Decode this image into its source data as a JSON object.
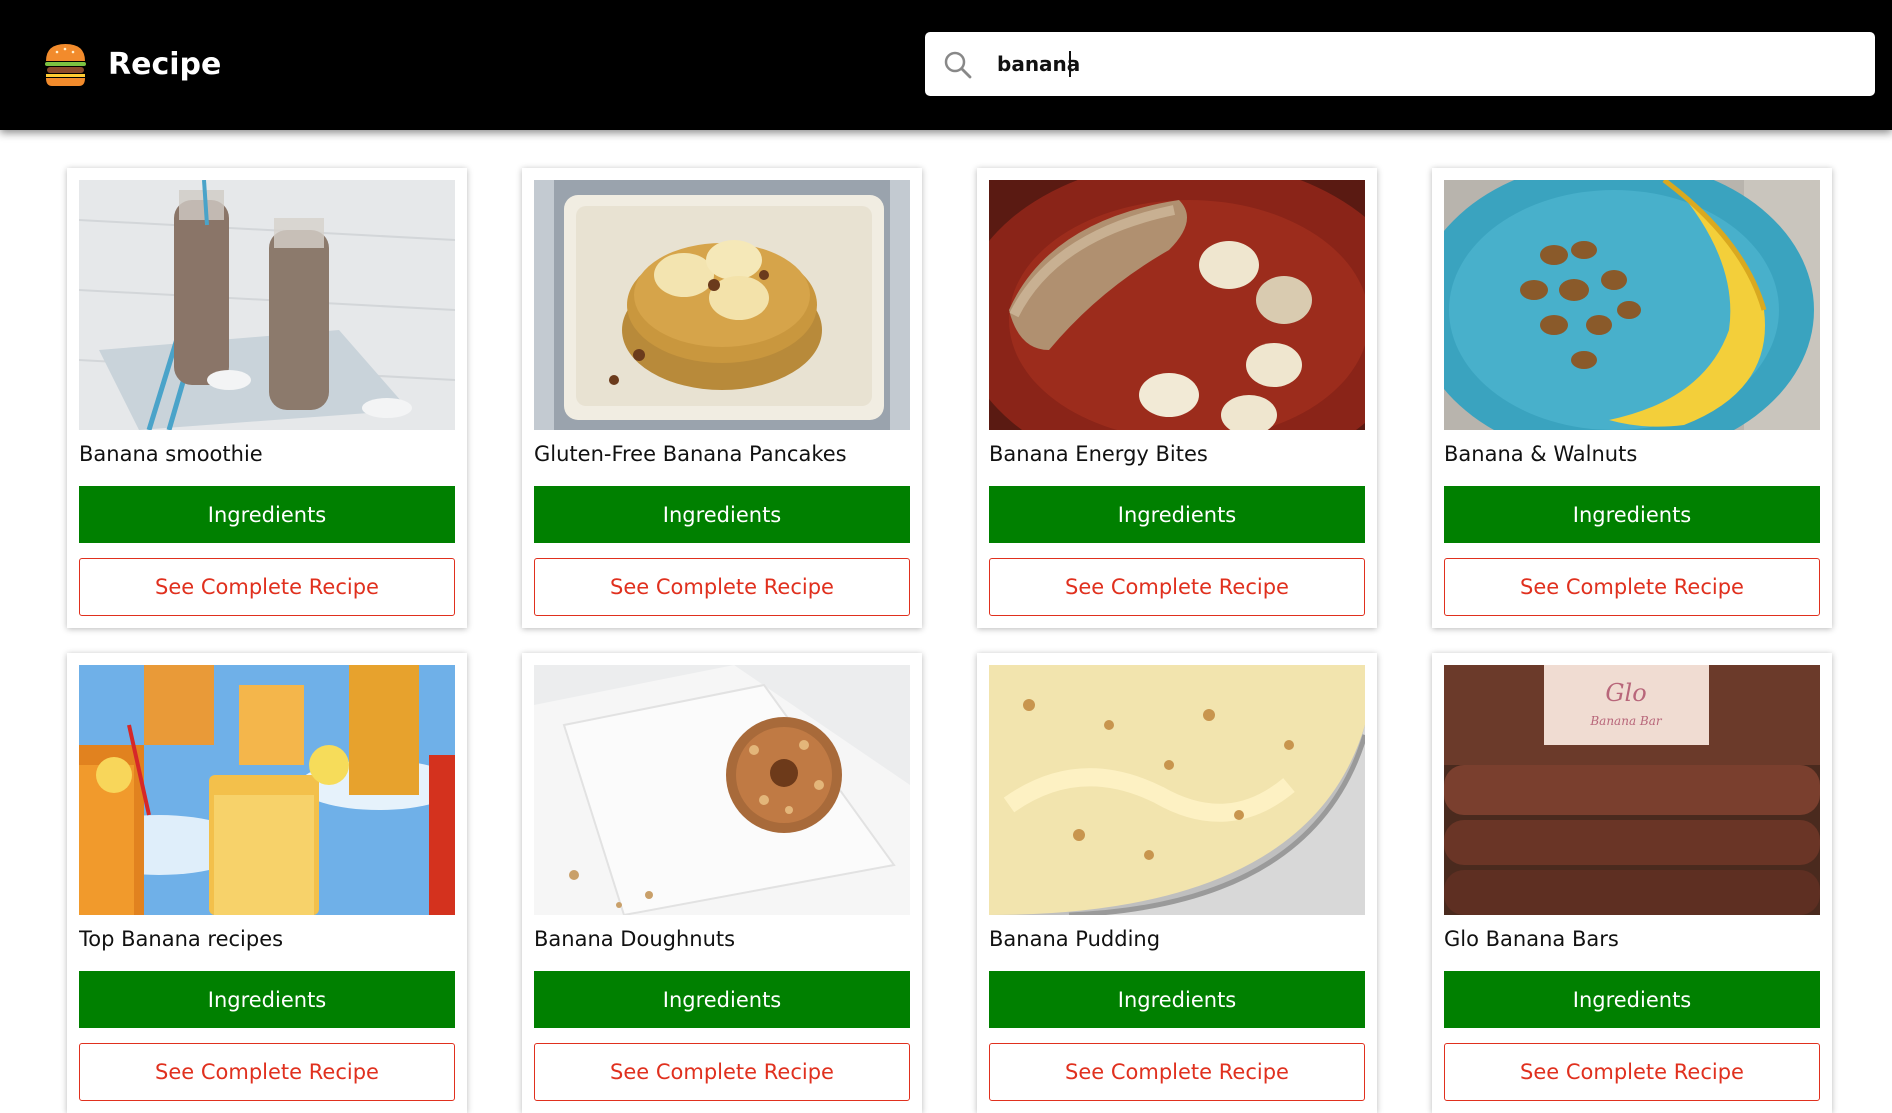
{
  "header": {
    "app_title": "Recipe",
    "logo_icon": "burger-icon",
    "search": {
      "icon": "search-icon",
      "value": "banana",
      "placeholder": ""
    }
  },
  "recipes": [
    {
      "title": "Banana smoothie",
      "ingredients_label": "Ingredients",
      "recipe_label": "See Complete Recipe"
    },
    {
      "title": "Gluten-Free Banana Pancakes",
      "ingredients_label": "Ingredients",
      "recipe_label": "See Complete Recipe"
    },
    {
      "title": "Banana Energy Bites",
      "ingredients_label": "Ingredients",
      "recipe_label": "See Complete Recipe"
    },
    {
      "title": "Banana & Walnuts",
      "ingredients_label": "Ingredients",
      "recipe_label": "See Complete Recipe"
    },
    {
      "title": "Top Banana recipes",
      "ingredients_label": "Ingredients",
      "recipe_label": "See Complete Recipe"
    },
    {
      "title": "Banana Doughnuts",
      "ingredients_label": "Ingredients",
      "recipe_label": "See Complete Recipe"
    },
    {
      "title": "Banana Pudding",
      "ingredients_label": "Ingredients",
      "recipe_label": "See Complete Recipe"
    },
    {
      "title": "Glo Banana Bars",
      "ingredients_label": "Ingredients",
      "recipe_label": "See Complete Recipe"
    }
  ],
  "photo_text": {
    "glo_label": "Glo",
    "glo_sublabel": "Banana Bar"
  },
  "colors": {
    "header_bg": "#000000",
    "ingredients_bg": "#008000",
    "recipe_accent": "#e0301e"
  }
}
